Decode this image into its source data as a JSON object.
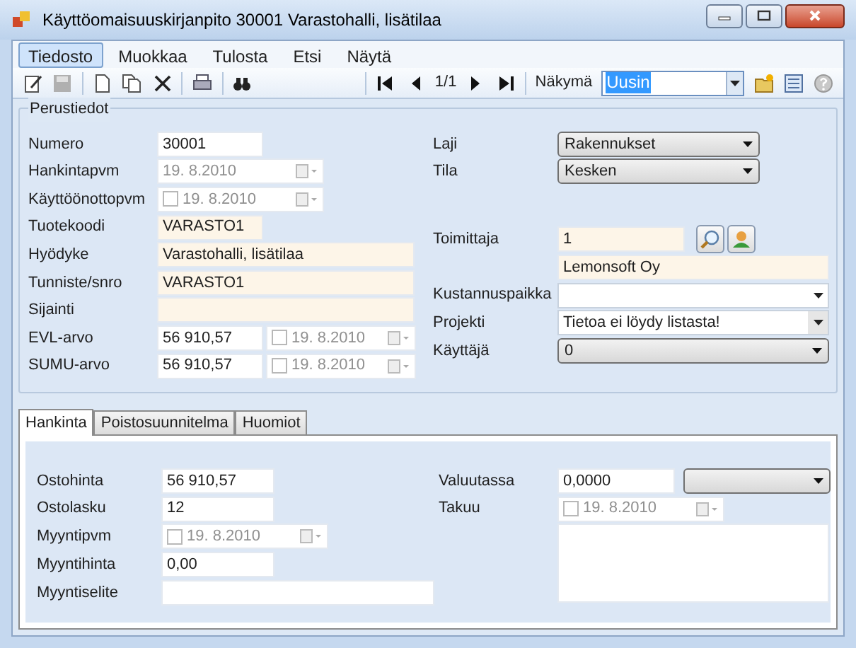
{
  "window": {
    "title": "Käyttöomaisuuskirjanpito 30001 Varastohalli, lisätilaa"
  },
  "menu": [
    {
      "label": "Tiedosto",
      "selected": true
    },
    {
      "label": "Muokkaa",
      "selected": false
    },
    {
      "label": "Tulosta",
      "selected": false
    },
    {
      "label": "Etsi",
      "selected": false
    },
    {
      "label": "Näytä",
      "selected": false
    }
  ],
  "toolbar": {
    "record_position": "1/1",
    "view_label": "Näkymä",
    "view_value": "Uusin"
  },
  "basic": {
    "title": "Perustiedot",
    "left": [
      {
        "label": "Numero",
        "fields": [
          {
            "kind": "text",
            "value": "30001",
            "highlighted": false
          }
        ]
      },
      {
        "label": "Hankintapvm",
        "fields": [
          {
            "kind": "date",
            "value": "19. 8.2010"
          }
        ]
      },
      {
        "label": "Käyttöönottopvm",
        "fields": [
          {
            "kind": "date",
            "value": "19. 8.2010",
            "checked": false
          }
        ]
      },
      {
        "label": "Tuotekoodi",
        "fields": [
          {
            "kind": "text",
            "value": "VARASTO1",
            "highlighted": true
          }
        ]
      },
      {
        "label": "Hyödyke",
        "fields": [
          {
            "kind": "text",
            "value": "Varastohalli, lisätilaa",
            "highlighted": true
          }
        ]
      },
      {
        "label": "Tunniste/snro",
        "fields": [
          {
            "kind": "text",
            "value": "VARASTO1",
            "highlighted": true
          }
        ]
      },
      {
        "label": "Sijainti",
        "fields": [
          {
            "kind": "text",
            "highlighted": true
          }
        ]
      },
      {
        "label": "EVL-arvo",
        "fields": [
          {
            "kind": "text",
            "value": "56 910,57",
            "highlighted": false
          },
          {
            "kind": "date",
            "value": "19. 8.2010",
            "checked": false
          }
        ]
      },
      {
        "label": "SUMU-arvo",
        "fields": [
          {
            "kind": "text",
            "value": "56 910,57",
            "highlighted": false
          },
          {
            "kind": "date",
            "value": "19. 8.2010",
            "checked": false
          }
        ]
      }
    ],
    "right": [
      {
        "label": "Laji",
        "fields": [
          {
            "kind": "combo",
            "value": "Rakennukset"
          }
        ]
      },
      {
        "label": "Tila",
        "fields": [
          {
            "kind": "combo",
            "value": "Kesken"
          }
        ]
      },
      {
        "label": "Toimittaja",
        "fields": [
          {
            "kind": "text",
            "value": "1",
            "highlighted": true
          },
          {
            "kind": "search_button"
          },
          {
            "kind": "person_button"
          }
        ]
      },
      {
        "fields": [
          {
            "kind": "text",
            "value": "Lemonsoft Oy",
            "highlighted": true
          }
        ]
      },
      {
        "label": "Kustannuspaikka",
        "fields": [
          {
            "kind": "dropdown"
          }
        ]
      },
      {
        "label": "Projekti",
        "fields": [
          {
            "kind": "dropdown",
            "value": "Tietoa ei löydy listasta!"
          }
        ]
      },
      {
        "label": "Käyttäjä",
        "fields": [
          {
            "kind": "combo",
            "value": "0"
          }
        ]
      }
    ]
  },
  "tabs": [
    {
      "label": "Hankinta",
      "selected": true
    },
    {
      "label": "Poistosuunnitelma",
      "selected": false
    },
    {
      "label": "Huomiot",
      "selected": false
    }
  ],
  "purchase": {
    "left": [
      {
        "label": "Ostohinta",
        "fields": [
          {
            "kind": "text",
            "value": "56 910,57",
            "highlighted": false
          }
        ]
      },
      {
        "label": "Ostolasku",
        "fields": [
          {
            "kind": "text",
            "value": "12",
            "highlighted": false
          }
        ]
      },
      {
        "label": "Myyntipvm",
        "fields": [
          {
            "kind": "date",
            "value": "19. 8.2010",
            "checked": false
          }
        ]
      },
      {
        "label": "Myyntihinta",
        "fields": [
          {
            "kind": "text",
            "value": "0,00",
            "highlighted": false
          }
        ]
      },
      {
        "label": "Myyntiselite",
        "fields": [
          {
            "kind": "text",
            "highlighted": false
          }
        ]
      }
    ],
    "right": [
      {
        "label": "Valuutassa",
        "fields": [
          {
            "kind": "text",
            "value": "0,0000",
            "highlighted": false
          },
          {
            "kind": "combo"
          }
        ]
      },
      {
        "label": "Takuu",
        "fields": [
          {
            "kind": "date",
            "value": "19. 8.2010",
            "checked": false
          }
        ]
      },
      {
        "fields": [
          {
            "kind": "memo"
          }
        ]
      }
    ]
  }
}
